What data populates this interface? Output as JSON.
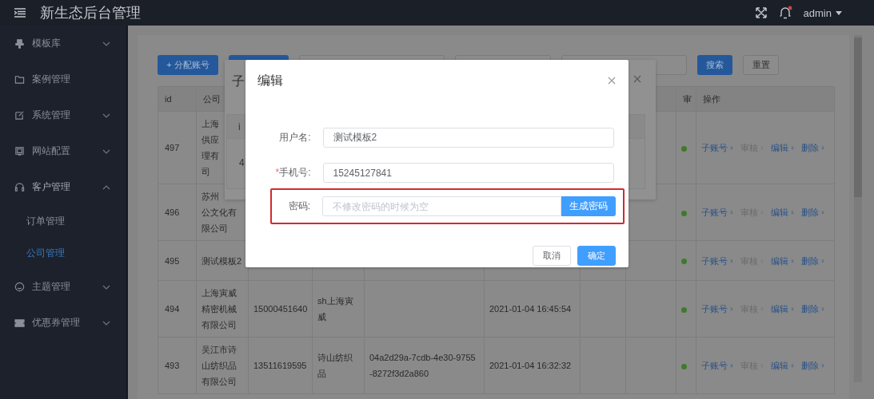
{
  "header": {
    "title": "新生态后台管理",
    "notification": true,
    "user": "admin"
  },
  "sidebar": {
    "items": [
      {
        "label": "模板库",
        "expanded": false
      },
      {
        "label": "案例管理"
      },
      {
        "label": "系统管理",
        "expanded": false
      },
      {
        "label": "网站配置",
        "expanded": false
      },
      {
        "label": "客户管理",
        "expanded": true,
        "children": [
          {
            "label": "订单管理",
            "selected": false
          },
          {
            "label": "公司管理",
            "selected": true
          }
        ]
      },
      {
        "label": "主题管理",
        "expanded": false
      },
      {
        "label": "优惠券管理",
        "expanded": false
      }
    ]
  },
  "toolbar": {
    "add_button": "+ 分配账号",
    "search_button": "搜索",
    "reset_button": "重置"
  },
  "table": {
    "columns": {
      "id": "id",
      "company": "公司",
      "column_9": "审",
      "actions": "操作"
    },
    "rows": [
      {
        "id": "497",
        "company": [
          "上海",
          "供应",
          "理有",
          "司"
        ],
        "enabled": true,
        "actions": [
          {
            "label": "子账号",
            "disabled": false
          },
          {
            "label": "审核",
            "disabled": true
          },
          {
            "label": "编辑",
            "disabled": false
          },
          {
            "label": "删除",
            "disabled": false
          }
        ]
      },
      {
        "id": "496",
        "company": [
          "苏州",
          "公文化有",
          "限公司"
        ],
        "enabled": true,
        "actions": [
          {
            "label": "子账号",
            "disabled": false
          },
          {
            "label": "审核",
            "disabled": true
          },
          {
            "label": "编辑",
            "disabled": false
          },
          {
            "label": "删除",
            "disabled": false
          }
        ]
      },
      {
        "id": "495",
        "company": [
          "测试模板2"
        ],
        "enabled": true,
        "actions": [
          {
            "label": "子账号",
            "disabled": false
          },
          {
            "label": "审核",
            "disabled": true
          },
          {
            "label": "编辑",
            "disabled": false
          },
          {
            "label": "删除",
            "disabled": false
          }
        ]
      },
      {
        "id": "494",
        "company": [
          "上海寅威",
          "精密机械",
          "有限公司"
        ],
        "phone": "15000451640",
        "name": [
          "sh上海寅",
          "威"
        ],
        "created": "2021-01-04 16:45:54",
        "enabled": true,
        "actions": [
          {
            "label": "子账号",
            "disabled": false
          },
          {
            "label": "审核",
            "disabled": true
          },
          {
            "label": "编辑",
            "disabled": false
          },
          {
            "label": "删除",
            "disabled": false
          }
        ]
      },
      {
        "id": "493",
        "company": [
          "吴江市诗",
          "山纺织品",
          "有限公司"
        ],
        "phone": "13511619595",
        "name": [
          "诗山纺织",
          "品"
        ],
        "uuid": [
          "04a2d29a-7cdb-4e30-9755",
          "-8272f3d2a860"
        ],
        "created": "2021-01-04 16:32:32",
        "enabled": true,
        "actions": [
          {
            "label": "子账号",
            "disabled": false
          },
          {
            "label": "审核",
            "disabled": true
          },
          {
            "label": "编辑",
            "disabled": false
          },
          {
            "label": "删除",
            "disabled": false
          }
        ]
      }
    ]
  },
  "sub_dialog": {
    "title": "子",
    "table_header": "i",
    "table_cell": "4"
  },
  "modal": {
    "title": "编辑",
    "fields": [
      {
        "label": "用户名:",
        "value": "测试模板2",
        "highlighted": false
      },
      {
        "label": "手机号:",
        "required_mark": "*",
        "value": "15245127841",
        "highlighted": false
      },
      {
        "label": "密码:",
        "placeholder": "不修改密码的时候为空",
        "highlighted": true,
        "button": "生成密码"
      }
    ],
    "cancel_button": "取消",
    "confirm_button": "确定"
  }
}
